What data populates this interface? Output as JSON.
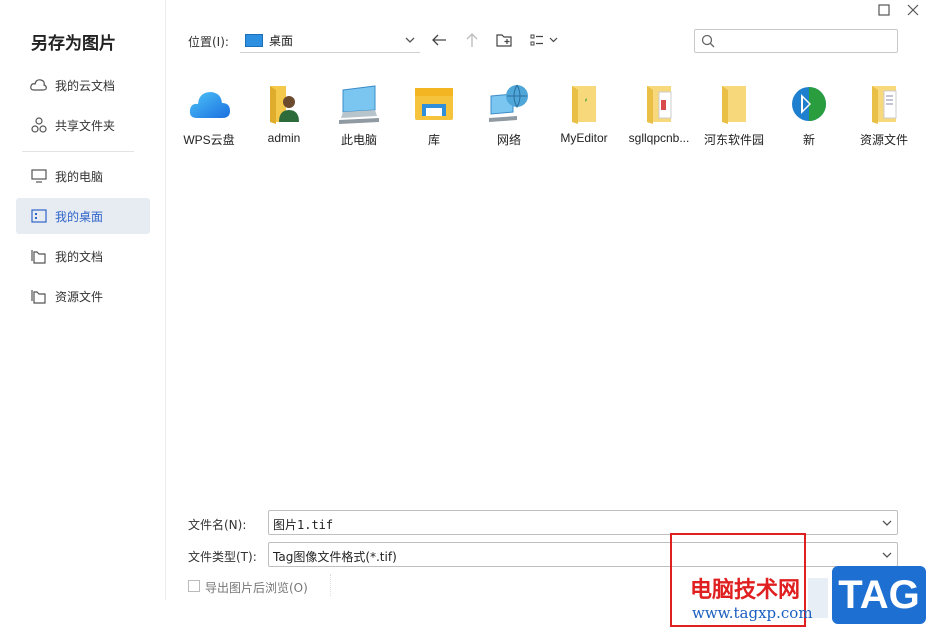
{
  "dialog": {
    "title": "另存为图片"
  },
  "sidebar": {
    "items": [
      {
        "label": "我的云文档",
        "icon": "cloud-icon",
        "active": false
      },
      {
        "label": "共享文件夹",
        "icon": "share-icon",
        "active": false
      },
      {
        "label": "我的电脑",
        "icon": "monitor-icon",
        "active": false
      },
      {
        "label": "我的桌面",
        "icon": "desktop-icon",
        "active": true
      },
      {
        "label": "我的文档",
        "icon": "documents-icon",
        "active": false
      },
      {
        "label": "资源文件",
        "icon": "folder-icon",
        "active": false
      }
    ]
  },
  "toolbar": {
    "location_label": "位置(I):",
    "location_value": "桌面",
    "back_icon": "arrow-left-icon",
    "up_icon": "arrow-up-icon",
    "new_folder_icon": "new-folder-icon",
    "view_icon": "list-view-icon",
    "search_placeholder": ""
  },
  "files": [
    {
      "label": "WPS云盘",
      "icon": "wps-cloud-icon"
    },
    {
      "label": "admin",
      "icon": "user-folder-icon"
    },
    {
      "label": "此电脑",
      "icon": "computer-icon"
    },
    {
      "label": "库",
      "icon": "library-icon"
    },
    {
      "label": "网络",
      "icon": "network-icon"
    },
    {
      "label": "MyEditor",
      "icon": "folder-icon"
    },
    {
      "label": "sgllqpcnb...",
      "icon": "folder-icon"
    },
    {
      "label": "河东软件园",
      "icon": "folder-icon"
    },
    {
      "label": "新",
      "icon": "app-shortcut-icon"
    },
    {
      "label": "资源文件",
      "icon": "folder-icon"
    }
  ],
  "form": {
    "filename_label": "文件名(N):",
    "filename_value": "图片1.tif",
    "filetype_label": "文件类型(T):",
    "filetype_value": "Tag图像文件格式(*.tif)",
    "browse_after_export_label": "导出图片后浏览(O)",
    "browse_after_export_checked": false
  },
  "watermark": {
    "title": "电脑技术网",
    "url": "www.tagxp.com",
    "tag": "TAG"
  },
  "colors": {
    "accent": "#2f64c8",
    "active_bg": "#e7ecf3",
    "watermark_red": "#e02020",
    "tag_blue": "#1d6fd1"
  }
}
